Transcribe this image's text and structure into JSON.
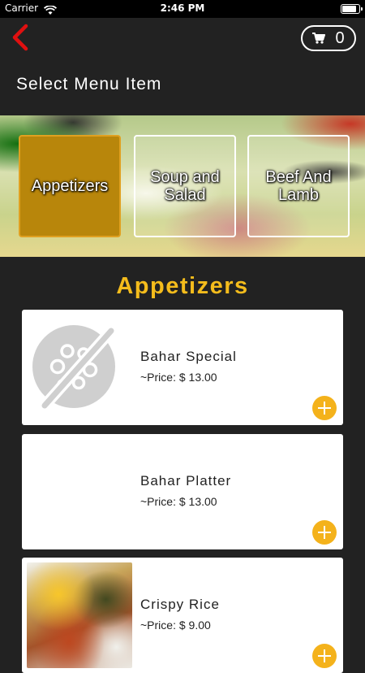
{
  "status_bar": {
    "carrier": "Carrier",
    "time": "2:46 PM"
  },
  "header": {
    "cart_count": "0",
    "title": "Select Menu Item"
  },
  "categories": [
    {
      "label": "Appetizers",
      "active": true
    },
    {
      "label": "Soup and Salad",
      "active": false
    },
    {
      "label": "Beef And Lamb",
      "active": false
    }
  ],
  "section": {
    "title": "Appetizers"
  },
  "items": [
    {
      "name": "Bahar Special",
      "price": "~Price: $ 13.00",
      "image": "placeholder-no-image-icon"
    },
    {
      "name": "Bahar Platter",
      "price": "~Price: $ 13.00",
      "image": "none"
    },
    {
      "name": "Crispy Rice",
      "price": "~Price: $ 9.00",
      "image": "food-photo"
    }
  ],
  "colors": {
    "accent": "#f4bc1c",
    "active_tile": "#b8860b",
    "back_arrow": "#e01010",
    "background": "#222222"
  }
}
